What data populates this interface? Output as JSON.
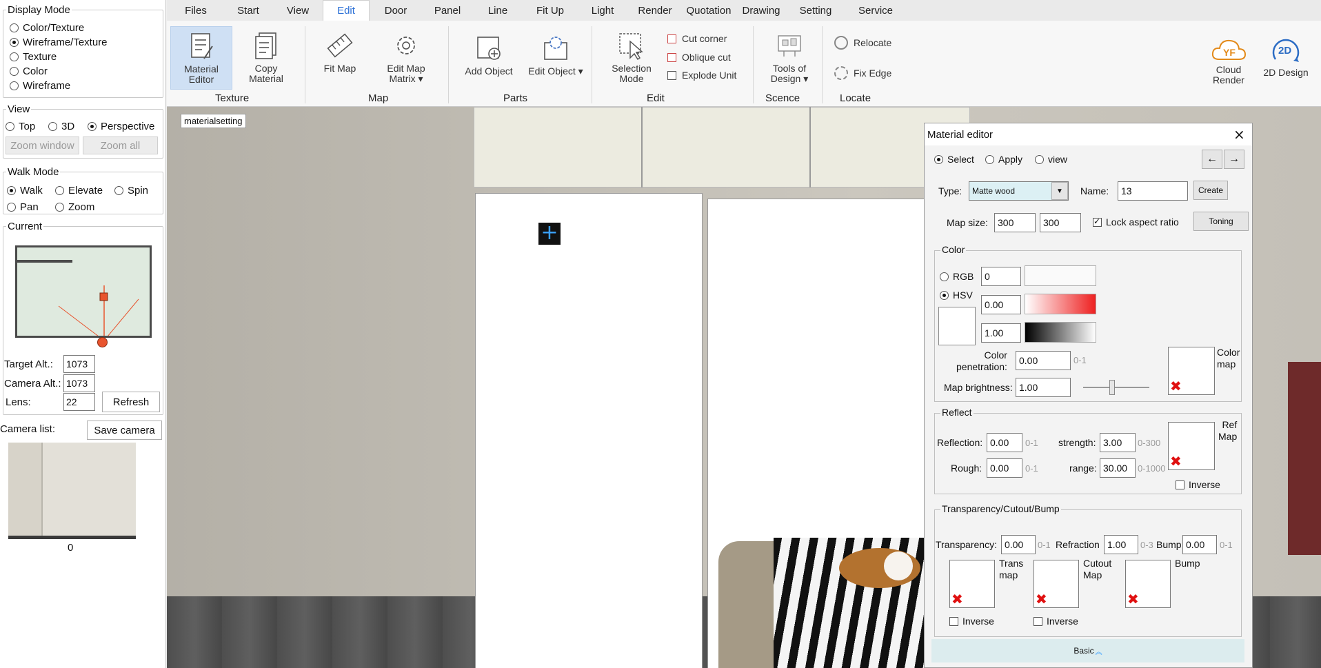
{
  "left_panel": {
    "display_mode": {
      "title": "Display Mode",
      "options": [
        "Color/Texture",
        "Wireframe/Texture",
        "Texture",
        "Color",
        "Wireframe"
      ],
      "selected": 1
    },
    "view": {
      "title": "View",
      "options": [
        "Top",
        "3D",
        "Perspective"
      ],
      "selected": 2,
      "zoom_window": "Zoom window",
      "zoom_all": "Zoom all"
    },
    "walk_mode": {
      "title": "Walk Mode",
      "options": [
        "Walk",
        "Elevate",
        "Spin",
        "Pan",
        "Zoom"
      ],
      "selected": 0
    },
    "current": {
      "title": "Current",
      "target_alt_label": "Target Alt.:",
      "target_alt": "1073",
      "camera_alt_label": "Camera Alt.:",
      "camera_alt": "1073",
      "lens_label": "Lens:",
      "lens": "22",
      "refresh": "Refresh"
    },
    "camera_list": {
      "label": "Camera list:",
      "save": "Save camera",
      "items": [
        "0"
      ]
    }
  },
  "ribbon": {
    "tabs": [
      "Files",
      "Start",
      "View",
      "Edit",
      "Door",
      "Panel",
      "Line",
      "Fit Up",
      "Light",
      "Render",
      "Quotation",
      "Drawing",
      "Setting",
      "Service"
    ],
    "active_tab": "Edit",
    "buttons": {
      "material_editor": "Material\nEditor",
      "copy_material": "Copy\nMaterial",
      "fit_map": "Fit Map",
      "edit_map_matrix": "Edit Map\nMatrix",
      "add_object": "Add Object",
      "edit_object": "Edit Object",
      "selection_mode": "Selection\nMode",
      "cut_corner": "Cut corner",
      "oblique_cut": "Oblique cut",
      "explode_unit": "Explode Unit",
      "tools_of_design": "Tools of\nDesign",
      "relocate": "Relocate",
      "fix_edge": "Fix Edge",
      "cloud_render": "Cloud\nRender",
      "design_2d": "2D Design"
    },
    "groups": {
      "texture": "Texture",
      "map": "Map",
      "parts": "Parts",
      "edit": "Edit",
      "scence": "Scence",
      "locate": "Locate"
    },
    "logo_text": "YF",
    "badge_2d": "2D"
  },
  "viewport": {
    "tag": "materialsetting"
  },
  "material_editor": {
    "title": "Material editor",
    "modes": [
      "Select",
      "Apply",
      "view"
    ],
    "mode_selected": 0,
    "type_label": "Type:",
    "type_value": "Matte wood",
    "name_label": "Name:",
    "name_value": "13",
    "create": "Create",
    "map_size_label": "Map size:",
    "map_w": "300",
    "map_h": "300",
    "lock_aspect": "Lock aspect ratio",
    "toning": "Toning",
    "color": {
      "title": "Color",
      "rgb": "RGB",
      "hsv": "HSV",
      "color_model_selected": "HSV",
      "h": "0",
      "s": "0.00",
      "v": "1.00",
      "penetration_label": "Color\npenetration:",
      "penetration": "0.00",
      "penetration_range": "0-1",
      "map_brightness_label": "Map brightness:",
      "map_brightness": "1.00",
      "color_map_label": "Color\nmap"
    },
    "reflect": {
      "title": "Reflect",
      "reflection_label": "Reflection:",
      "reflection": "0.00",
      "reflection_range": "0-1",
      "strength_label": "strength:",
      "strength": "3.00",
      "strength_range": "0-300",
      "rough_label": "Rough:",
      "rough": "0.00",
      "rough_range": "0-1",
      "range_label": "range:",
      "range": "30.00",
      "range_range": "0-1000",
      "ref_map_label": "Ref\nMap",
      "inverse": "Inverse"
    },
    "tcb": {
      "title": "Transparency/Cutout/Bump",
      "transparency_label": "Transparency:",
      "transparency": "0.00",
      "transparency_range": "0-1",
      "refraction_label": "Refraction",
      "refraction": "1.00",
      "refraction_range": "0-3",
      "bump_label": "Bump",
      "bump": "0.00",
      "bump_range": "0-1",
      "trans_map_label": "Trans\nmap",
      "cutout_map_label": "Cutout\nMap",
      "bump_map_label": "Bump",
      "inverse": "Inverse"
    },
    "basic": "Basic"
  }
}
